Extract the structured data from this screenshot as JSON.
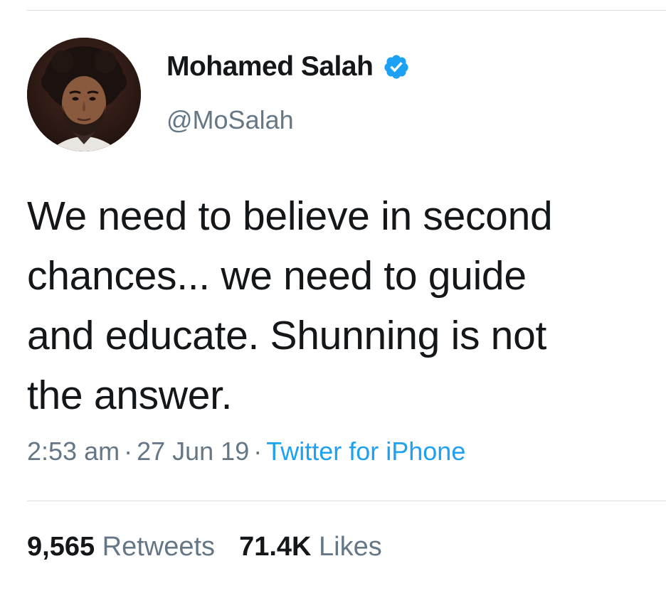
{
  "tweet": {
    "author": {
      "display_name": "Mohamed Salah",
      "handle": "@MoSalah",
      "verified": true
    },
    "text": "We need to believe in second\nchances... we need to guide\nand educate. Shunning is not\nthe answer.",
    "time": "2:53 am",
    "date": "27 Jun 19",
    "separator": "·",
    "source": "Twitter for iPhone",
    "stats": {
      "retweets_count": "9,565",
      "retweets_label": "Retweets",
      "likes_count": "71.4K",
      "likes_label": "Likes"
    }
  },
  "colors": {
    "text_primary": "#14171a",
    "text_secondary": "#657786",
    "link": "#1da1f2",
    "verified_badge": "#1da1f2",
    "divider": "#dcdcdc"
  },
  "icons": {
    "verified": "verified-badge-icon",
    "avatar": "profile-photo"
  }
}
